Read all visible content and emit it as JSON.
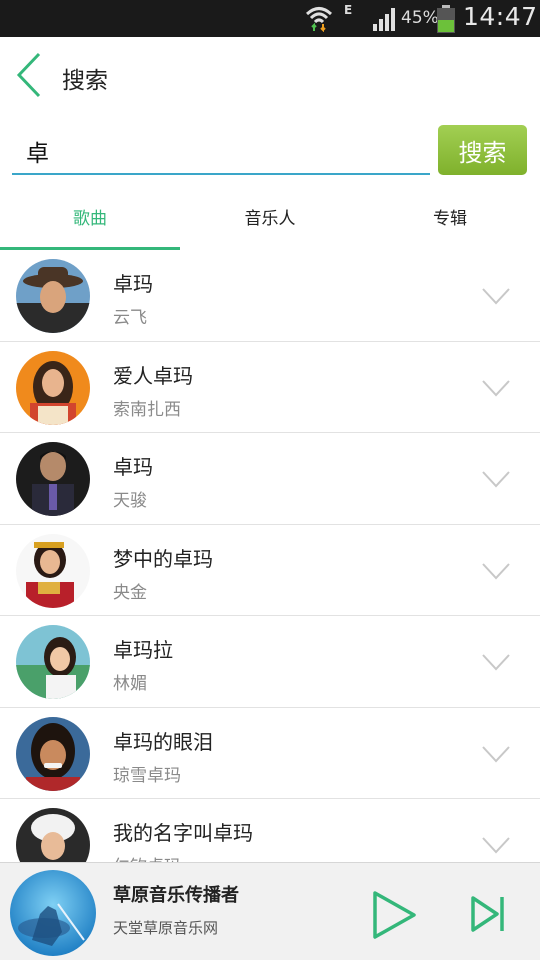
{
  "status_bar": {
    "network_type": "E",
    "battery_percent": "45%",
    "time": "14:47"
  },
  "header": {
    "title": "搜索"
  },
  "search": {
    "query": "卓",
    "button_label": "搜索"
  },
  "tabs": [
    {
      "label": "歌曲",
      "active": true
    },
    {
      "label": "音乐人",
      "active": false
    },
    {
      "label": "专辑",
      "active": false
    }
  ],
  "songs": [
    {
      "title": "卓玛",
      "artist": "云飞"
    },
    {
      "title": "爱人卓玛",
      "artist": "索南扎西"
    },
    {
      "title": "卓玛",
      "artist": "天骏"
    },
    {
      "title": "梦中的卓玛",
      "artist": "央金"
    },
    {
      "title": "卓玛拉",
      "artist": "林媚"
    },
    {
      "title": "卓玛的眼泪",
      "artist": "琼雪卓玛"
    },
    {
      "title": "我的名字叫卓玛",
      "artist": "仁钦卓玛"
    }
  ],
  "player": {
    "title": "草原音乐传播者",
    "subtitle": "天堂草原音乐网"
  },
  "colors": {
    "accent_green": "#34b77a",
    "search_button_green": "#8bbf3a",
    "input_underline": "#3aa6c9",
    "status_bar_bg": "#1a1a1a"
  }
}
